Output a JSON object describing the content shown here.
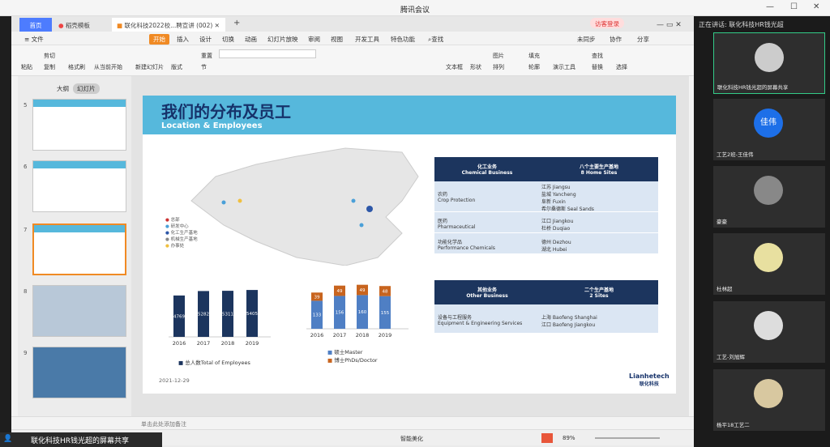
{
  "app": {
    "title": "腾讯会议"
  },
  "tabs": {
    "home": "首页",
    "templates": "稻壳模板",
    "doc": "联化科技2022校...聘宣讲 (002)"
  },
  "account": {
    "login": "访客登录"
  },
  "menu": {
    "file": "文件",
    "start": "开始",
    "insert": "插入",
    "design": "设计",
    "switch": "切换",
    "animation": "动画",
    "slideshow": "幻灯片放映",
    "review": "审阅",
    "view": "视图",
    "dev": "开发工具",
    "special": "特色功能",
    "search": "查找",
    "sync": "未同步",
    "collab": "协作",
    "share": "分享"
  },
  "ribbon": {
    "paste": "粘贴",
    "cut": "剪切",
    "copy": "复制",
    "format_painter": "格式刷",
    "from_start": "从当前开始",
    "new_slide": "新建幻灯片",
    "layout": "版式",
    "section": "节",
    "reset": "重置",
    "textbox": "文本框",
    "shape": "形状",
    "arrange": "排列",
    "picture": "图片",
    "fill": "填充",
    "outline": "轮廓",
    "slideshow_tool": "演示工具",
    "find": "查找",
    "replace": "替换",
    "select": "选择"
  },
  "panel": {
    "outline": "大纲",
    "slides": "幻灯片",
    "add": "+",
    "notes": "单击此处添加备注"
  },
  "slide_numbers": [
    "5",
    "6",
    "7",
    "8",
    "9"
  ],
  "slide": {
    "title": "我们的分布及员工",
    "subtitle": "Location & Employees",
    "date": "2021-12-29",
    "logo_en": "Lianhetech",
    "logo_cn": "联化科技",
    "legend_map": [
      "总部",
      "研发中心",
      "化工生产基地",
      "机械生产基地",
      "办事处"
    ],
    "table1": {
      "h1_cn": "化工业务",
      "h1_en": "Chemical Business",
      "h2_cn": "八个主要生产基地",
      "h2_en": "8 Home Sites",
      "rows": [
        {
          "cn": "农药",
          "en": "Crop Protection",
          "sites": [
            "江苏 Jiangsu",
            "盐城 Yancheng",
            "阜新 Fuxin",
            "希尔桑德斯 Seal Sands"
          ]
        },
        {
          "cn": "医药",
          "en": "Pharmaceutical",
          "sites": [
            "江口 Jiangkou",
            "杜桥 Duqiao"
          ]
        },
        {
          "cn": "功能化学品",
          "en": "Performance Chemicals",
          "sites": [
            "德州 Dezhou",
            "湖北 Hubei"
          ]
        }
      ]
    },
    "table2": {
      "h1_cn": "其他业务",
      "h1_en": "Other Business",
      "h2_cn": "二个生产基地",
      "h2_en": "2 Sites",
      "rows": [
        {
          "cn": "设备与工程服务",
          "en": "Equipment & Engineering Services",
          "sites": [
            "上海 Baofeng Shanghai",
            "江口 Baofeng Jiangkou"
          ]
        }
      ]
    }
  },
  "chart_data": [
    {
      "type": "bar",
      "categories": [
        "2016",
        "2017",
        "2018",
        "2019"
      ],
      "values": [
        4769,
        5282,
        5311,
        5405
      ],
      "legend": "总人数Total of Employees",
      "color": "#1c355e"
    },
    {
      "type": "bar",
      "stacked": true,
      "categories": [
        "2016",
        "2017",
        "2018",
        "2019"
      ],
      "series": [
        {
          "name": "硕士Master",
          "values": [
            133,
            156,
            160,
            155
          ],
          "color": "#4f7fc4"
        },
        {
          "name": "博士PhDs/Doctor",
          "values": [
            39,
            49,
            49,
            48
          ],
          "color": "#c8641e"
        }
      ]
    }
  ],
  "statusbar": {
    "smart": "智能美化",
    "zoom": "89%"
  },
  "meeting": {
    "speaking": "正在讲话: 联化科技HR钱光超",
    "share_label": "联化科技HR钱光超的屏幕共享",
    "participants": [
      {
        "name": "联化科技HR钱光超的屏幕共享"
      },
      {
        "name": "工艺2班-王佳伟",
        "avatar_text": "佳伟"
      },
      {
        "name": "豪豪"
      },
      {
        "name": "杜林超"
      },
      {
        "name": "工艺-刘旭辉"
      },
      {
        "name": "杨平18工艺二"
      }
    ]
  }
}
